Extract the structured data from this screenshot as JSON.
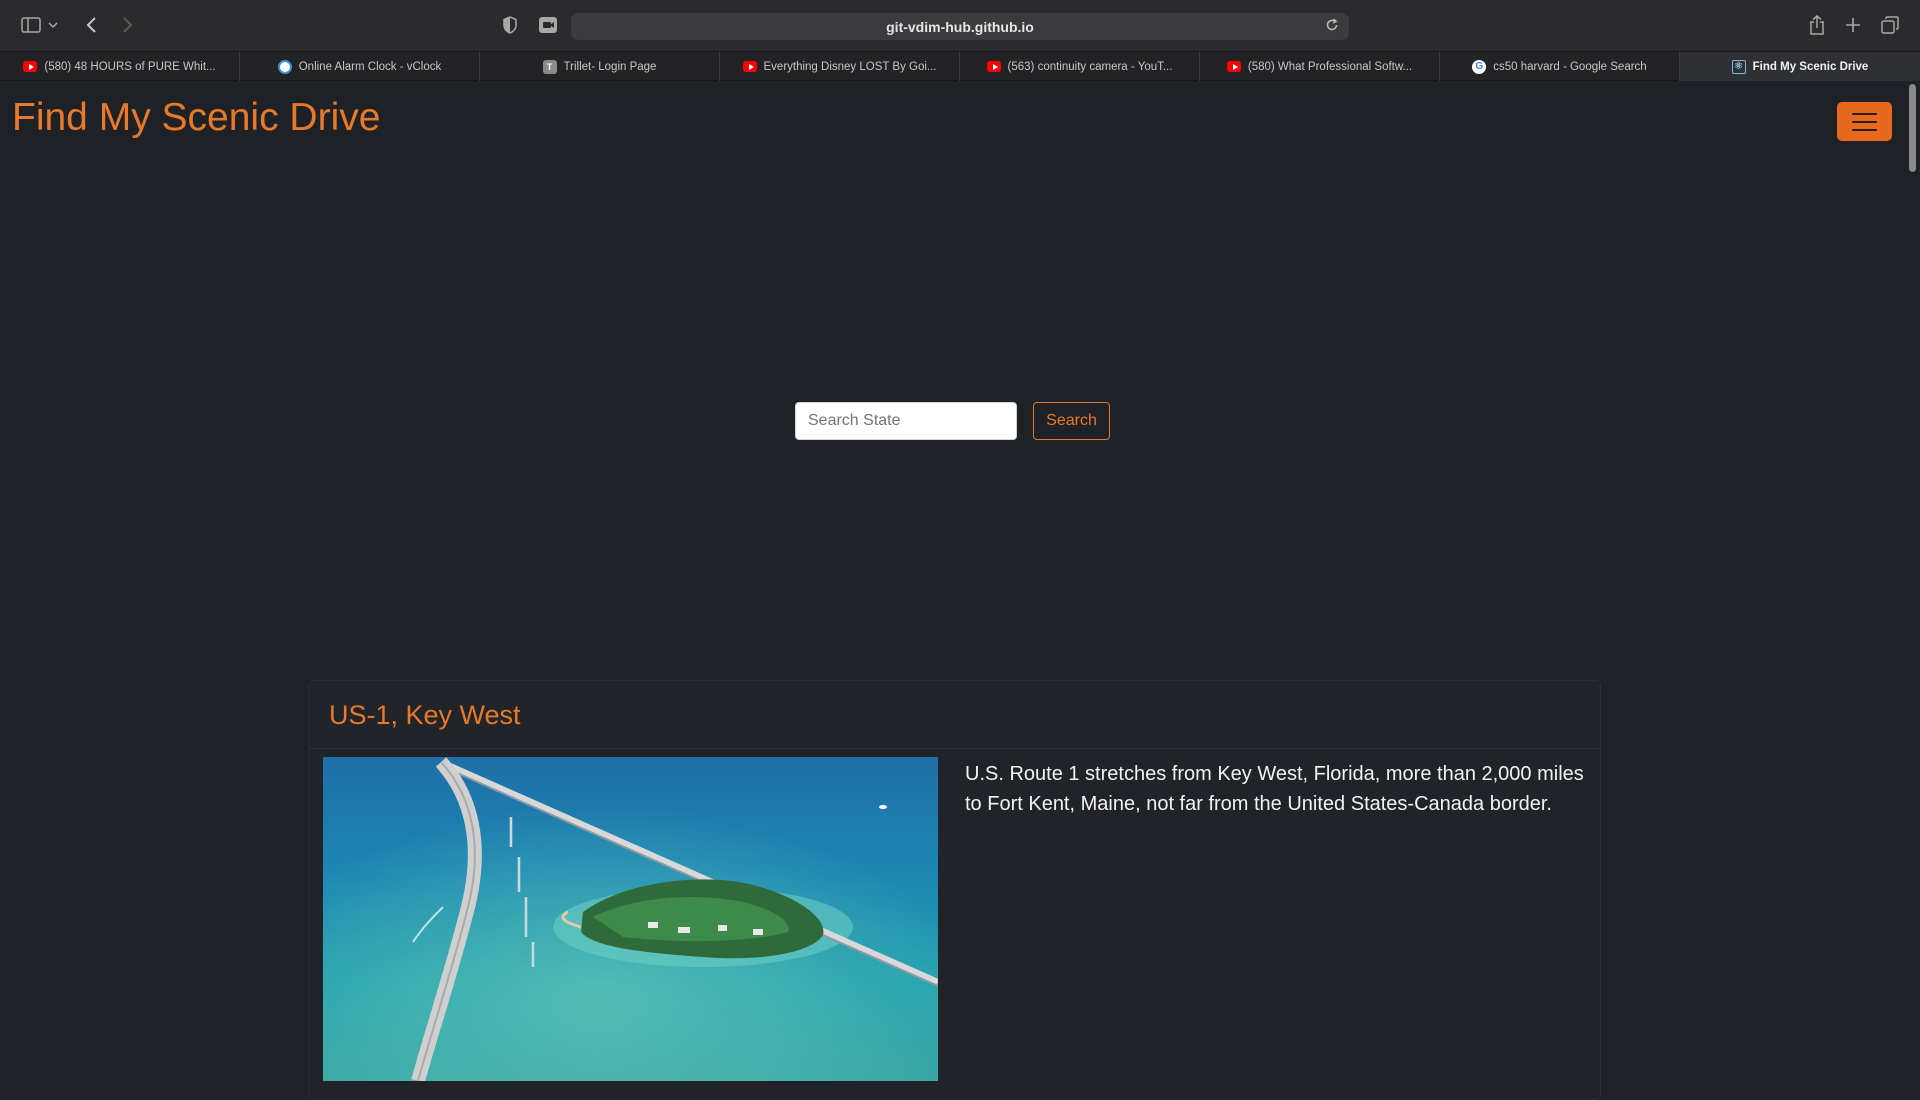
{
  "browser": {
    "url": "git-vdim-hub.github.io",
    "tabs": [
      {
        "label": "(580) 48 HOURS of PURE Whit...",
        "icon": "youtube-icon"
      },
      {
        "label": "Online Alarm Clock - vClock",
        "icon": "clock-icon"
      },
      {
        "label": "Trillet- Login Page",
        "icon": "t-icon"
      },
      {
        "label": "Everything Disney LOST By Goi...",
        "icon": "youtube-icon"
      },
      {
        "label": "(563) continuity camera - YouT...",
        "icon": "youtube-icon"
      },
      {
        "label": "(580) What Professional Softw...",
        "icon": "youtube-icon"
      },
      {
        "label": "cs50 harvard - Google Search",
        "icon": "google-icon"
      },
      {
        "label": "Find My Scenic Drive",
        "icon": "react-icon"
      }
    ]
  },
  "site": {
    "brand": "Find My Scenic Drive",
    "accent_color": "#e8792a"
  },
  "search": {
    "placeholder": "Search State",
    "button_label": "Search"
  },
  "card": {
    "title": "US-1, Key West",
    "description": "U.S. Route 1 stretches from Key West, Florida, more than 2,000 miles to Fort Kent, Maine, not far from the United States-Canada border."
  }
}
